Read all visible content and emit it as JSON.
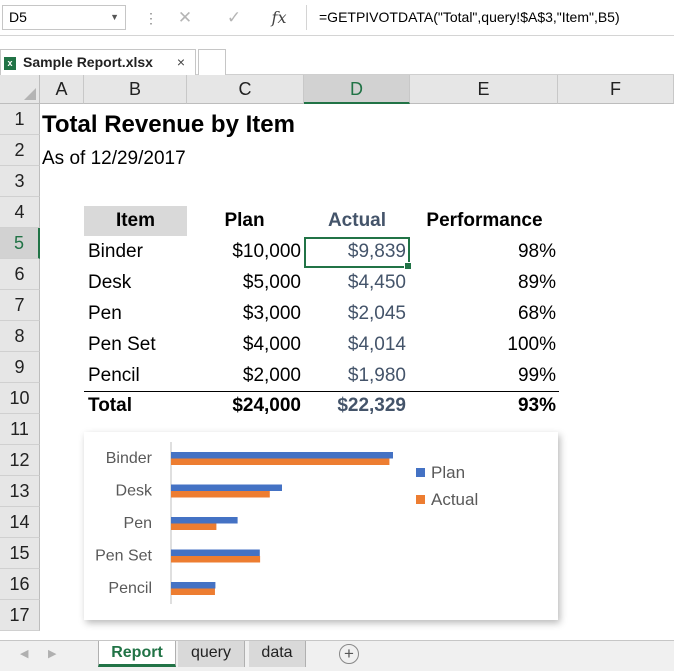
{
  "formula_bar": {
    "name_box": "D5",
    "cancel_icon": "✕",
    "enter_icon": "✓",
    "fx_label": "fx",
    "formula": "=GETPIVOTDATA(\"Total\",query!$A$3,\"Item\",B5)"
  },
  "workbook_tab": {
    "title": "Sample Report.xlsx",
    "close": "×"
  },
  "columns": [
    "A",
    "B",
    "C",
    "D",
    "E",
    "F"
  ],
  "selected_column": "D",
  "rows": [
    "1",
    "2",
    "3",
    "4",
    "5",
    "6",
    "7",
    "8",
    "9",
    "10",
    "11",
    "12",
    "13",
    "14",
    "15",
    "16",
    "17"
  ],
  "selected_row": "5",
  "report": {
    "title": "Total Revenue by Item",
    "subtitle": "As of 12/29/2017",
    "headers": {
      "item": "Item",
      "plan": "Plan",
      "actual": "Actual",
      "performance": "Performance"
    },
    "items": [
      {
        "item": "Binder",
        "plan": "$10,000",
        "actual": "$9,839",
        "performance": "98%"
      },
      {
        "item": "Desk",
        "plan": "$5,000",
        "actual": "$4,450",
        "performance": "89%"
      },
      {
        "item": "Pen",
        "plan": "$3,000",
        "actual": "$2,045",
        "performance": "68%"
      },
      {
        "item": "Pen Set",
        "plan": "$4,000",
        "actual": "$4,014",
        "performance": "100%"
      },
      {
        "item": "Pencil",
        "plan": "$2,000",
        "actual": "$1,980",
        "performance": "99%"
      }
    ],
    "total": {
      "item": "Total",
      "plan": "$24,000",
      "actual": "$22,329",
      "performance": "93%"
    }
  },
  "chart_data": {
    "type": "bar",
    "orientation": "horizontal",
    "categories": [
      "Binder",
      "Desk",
      "Pen",
      "Pen Set",
      "Pencil"
    ],
    "series": [
      {
        "name": "Plan",
        "values": [
          10000,
          5000,
          3000,
          4000,
          2000
        ],
        "color": "#4472c4"
      },
      {
        "name": "Actual",
        "values": [
          9839,
          4450,
          2045,
          4014,
          1980
        ],
        "color": "#ed7d31"
      }
    ],
    "legend_position": "right",
    "grid": false
  },
  "sheet_tabs": [
    {
      "label": "Report",
      "active": true
    },
    {
      "label": "query",
      "active": false
    },
    {
      "label": "data",
      "active": false
    }
  ],
  "add_sheet": "+"
}
